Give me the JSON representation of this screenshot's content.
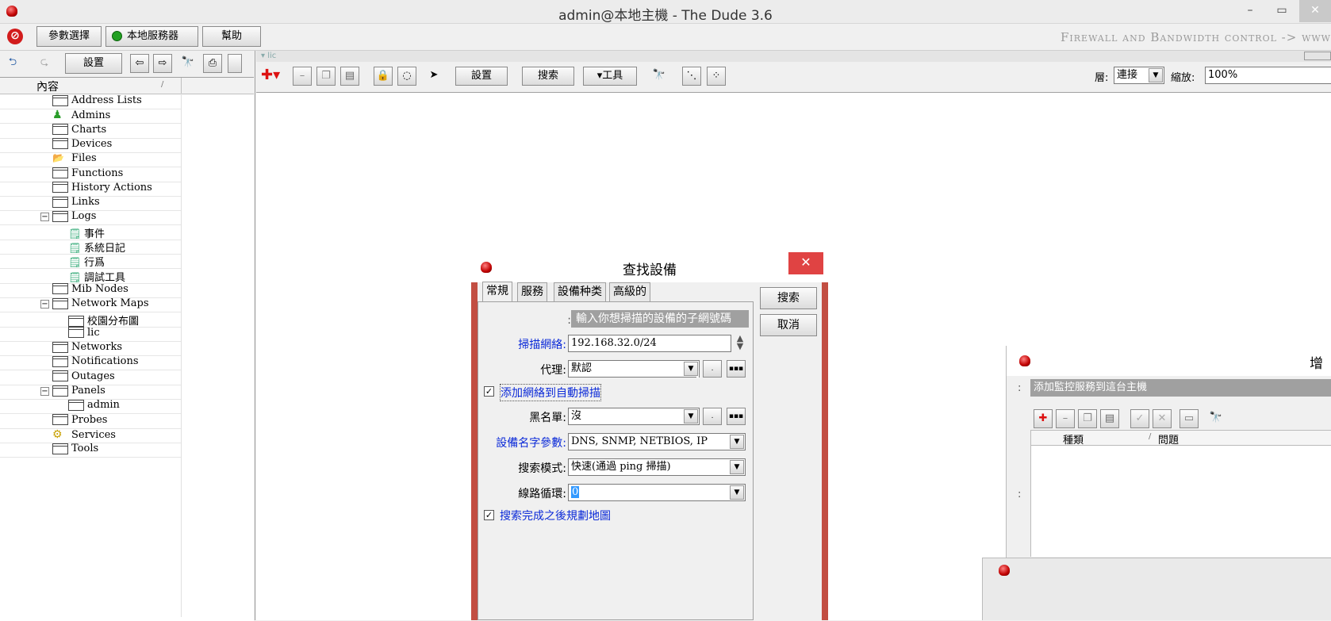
{
  "window": {
    "title": "admin@本地主機 - The Dude 3.6",
    "minimize": "–",
    "maximize": "▭",
    "close": "✕"
  },
  "menubar": {
    "options": "參數選擇",
    "server": "本地服務器",
    "help": "幫助",
    "banner": "Firewall and Bandwidth control -> www",
    "server_status_color": "#22a022"
  },
  "left_toolbar": {
    "back": "⮌",
    "forward": "⮎",
    "settings": "設置"
  },
  "tree": {
    "header": "內容",
    "sort_marker": "/",
    "items": [
      {
        "label": "Address Lists"
      },
      {
        "label": "Admins"
      },
      {
        "label": "Charts"
      },
      {
        "label": "Devices"
      },
      {
        "label": "Files"
      },
      {
        "label": "Functions"
      },
      {
        "label": "History Actions"
      },
      {
        "label": "Links"
      },
      {
        "label": "Logs"
      },
      {
        "label": "事件"
      },
      {
        "label": "系統日記"
      },
      {
        "label": "行爲"
      },
      {
        "label": "調試工具"
      },
      {
        "label": "Mib Nodes"
      },
      {
        "label": "Network Maps"
      },
      {
        "label": "校園分布圖"
      },
      {
        "label": "lic"
      },
      {
        "label": "Networks"
      },
      {
        "label": "Notifications"
      },
      {
        "label": "Outages"
      },
      {
        "label": "Panels"
      },
      {
        "label": "admin"
      },
      {
        "label": "Probes"
      },
      {
        "label": "Services"
      },
      {
        "label": "Tools"
      }
    ]
  },
  "map": {
    "tab": "lic",
    "settings": "設置",
    "search": "搜索",
    "tools": "▾工具",
    "layer_label": "層:",
    "layer_value": "連接",
    "zoom_label": "縮放:",
    "zoom_value": "100%"
  },
  "dialog": {
    "title": "查找設備",
    "tabs": [
      "常規",
      "服務",
      "設備种类",
      "高級的"
    ],
    "search_button": "搜索",
    "cancel_button": "取消",
    "hint": "輸入你想掃描的設備的子網號碼",
    "hint_prefix": ":",
    "scan_network_label": "掃描網絡:",
    "scan_network_value": "192.168.32.0/24",
    "agent_label": "代理:",
    "agent_value": "默認",
    "add_auto_scan": "添加網絡到自動掃描",
    "blacklist_label": "黑名單:",
    "blacklist_value": "沒",
    "name_params_label": "設備名字參數:",
    "name_params_value": "DNS, SNMP, NETBIOS, IP",
    "mode_label": "搜索模式:",
    "mode_value": "快速(通過 ping 掃描)",
    "loop_label": "線路循環:",
    "loop_value": "0",
    "layout_after": "搜索完成之後規劃地圖"
  },
  "panel2": {
    "title": "增",
    "hint": "添加監控服務到這台主機",
    "hint_prefix": ":",
    "col_type": "種類",
    "col_problem": "問題",
    "sort_marker": "/",
    "side_colon": ":"
  }
}
